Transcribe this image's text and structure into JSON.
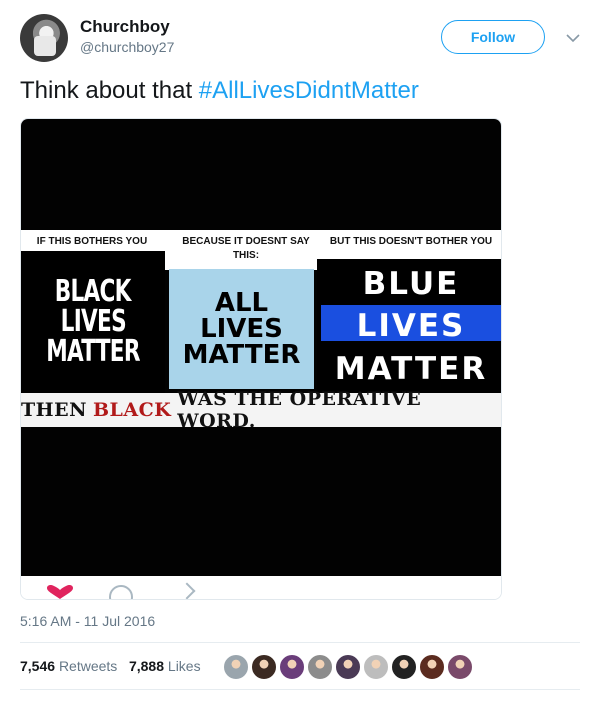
{
  "user": {
    "display_name": "Churchboy",
    "handle": "@churchboy27"
  },
  "follow_label": "Follow",
  "tweet": {
    "text_prefix": "Think about that ",
    "hashtag": "#AllLivesDidntMatter"
  },
  "media": {
    "captions": [
      "IF THIS BOTHERS YOU",
      "BECAUSE IT DOESNT SAY THIS:",
      "BUT THIS DOESN'T BOTHER YOU"
    ],
    "panel_black": [
      "BLACK",
      "LIVES",
      "MATTER"
    ],
    "panel_all": [
      "ALL",
      "LIVES",
      "MATTER"
    ],
    "panel_blue": [
      "BLUE",
      "LIVES",
      "MATTER"
    ],
    "bottom_line": {
      "before": "THEN",
      "highlight": "BLACK",
      "after": "WAS THE OPERATIVE WORD."
    }
  },
  "timestamp": "5:16 AM - 11 Jul 2016",
  "stats": {
    "retweets_count": "7,546",
    "retweets_label": "Retweets",
    "likes_count": "7,888",
    "likes_label": "Likes"
  },
  "liker_colors": [
    "#9aa5ad",
    "#3b2a22",
    "#6a3d7a",
    "#8c8c8c",
    "#4a3a55",
    "#bdbdbd",
    "#222222",
    "#5b2b1f",
    "#7a4a6a"
  ],
  "icons": [
    "chevron-down-icon",
    "heart-icon",
    "reply-icon",
    "retweet-icon"
  ]
}
